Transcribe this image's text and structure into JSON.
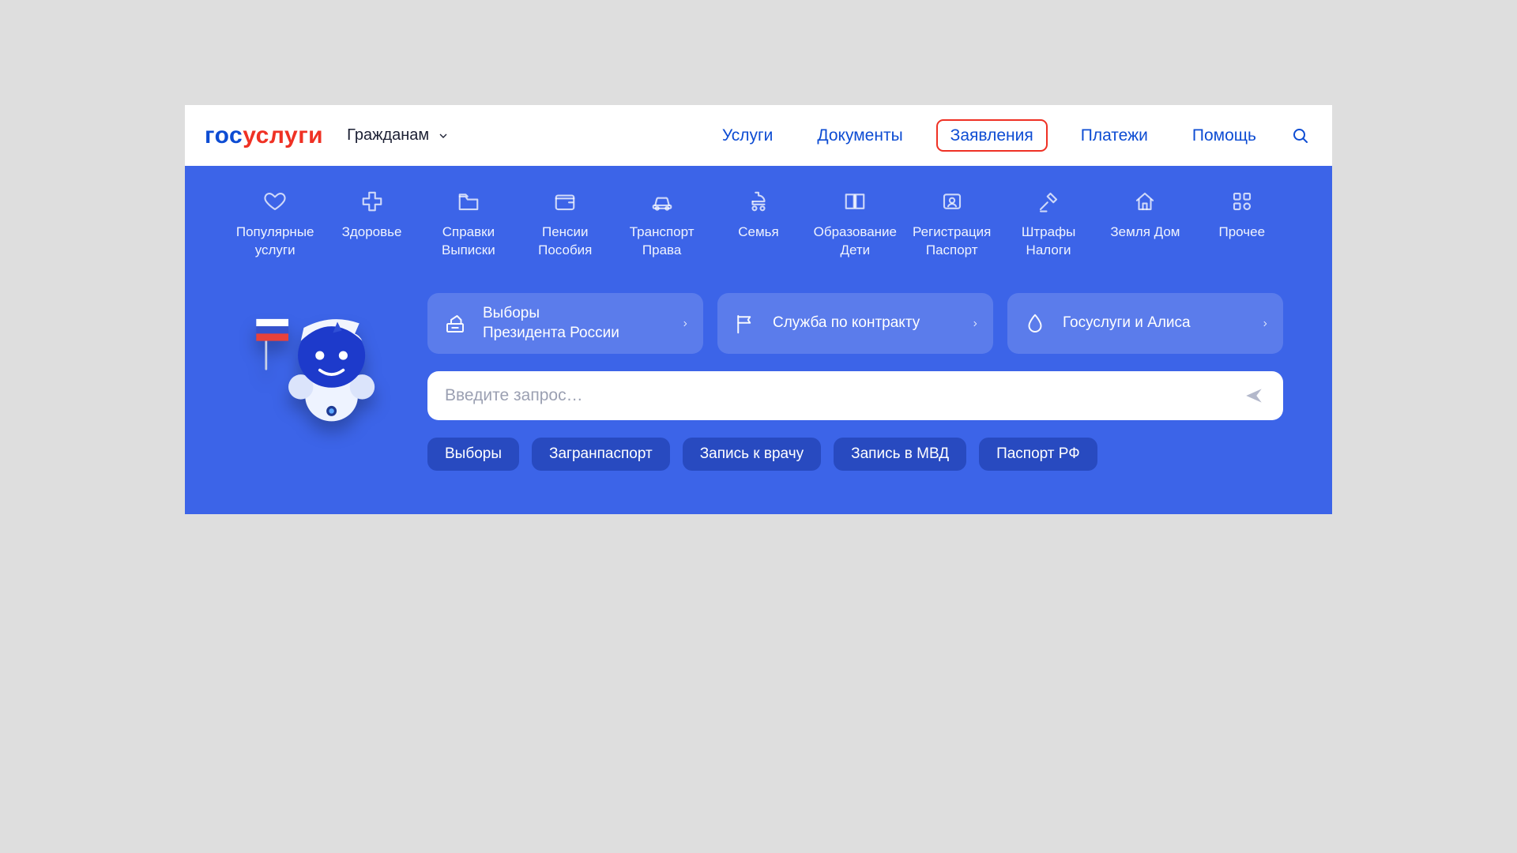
{
  "logo": {
    "t1": "гос",
    "t2": "услуги"
  },
  "audience": {
    "label": "Гражданам"
  },
  "nav": {
    "items": [
      {
        "label": "Услуги",
        "highlight": false
      },
      {
        "label": "Документы",
        "highlight": false
      },
      {
        "label": "Заявления",
        "highlight": true
      },
      {
        "label": "Платежи",
        "highlight": false
      },
      {
        "label": "Помощь",
        "highlight": false
      }
    ]
  },
  "categories": [
    {
      "icon": "heart",
      "label": "Популярные\nуслуги"
    },
    {
      "icon": "plus-medical",
      "label": "Здоровье"
    },
    {
      "icon": "folder",
      "label": "Справки\nВыписки"
    },
    {
      "icon": "wallet",
      "label": "Пенсии\nПособия"
    },
    {
      "icon": "car",
      "label": "Транспорт\nПрава"
    },
    {
      "icon": "stroller",
      "label": "Семья"
    },
    {
      "icon": "book",
      "label": "Образование\nДети"
    },
    {
      "icon": "id-card",
      "label": "Регистрация\nПаспорт"
    },
    {
      "icon": "gavel",
      "label": "Штрафы\nНалоги"
    },
    {
      "icon": "house",
      "label": "Земля Дом"
    },
    {
      "icon": "grid",
      "label": "Прочее"
    }
  ],
  "tiles": [
    {
      "icon": "ballot",
      "label": "Выборы\nПрезидента России"
    },
    {
      "icon": "flag",
      "label": "Служба по контракту"
    },
    {
      "icon": "drop",
      "label": "Госуслуги и Алиса"
    }
  ],
  "search": {
    "placeholder": "Введите запрос…"
  },
  "chips": [
    {
      "label": "Выборы"
    },
    {
      "label": "Загранпаспорт"
    },
    {
      "label": "Запись к врачу"
    },
    {
      "label": "Запись в МВД"
    },
    {
      "label": "Паспорт РФ"
    }
  ]
}
